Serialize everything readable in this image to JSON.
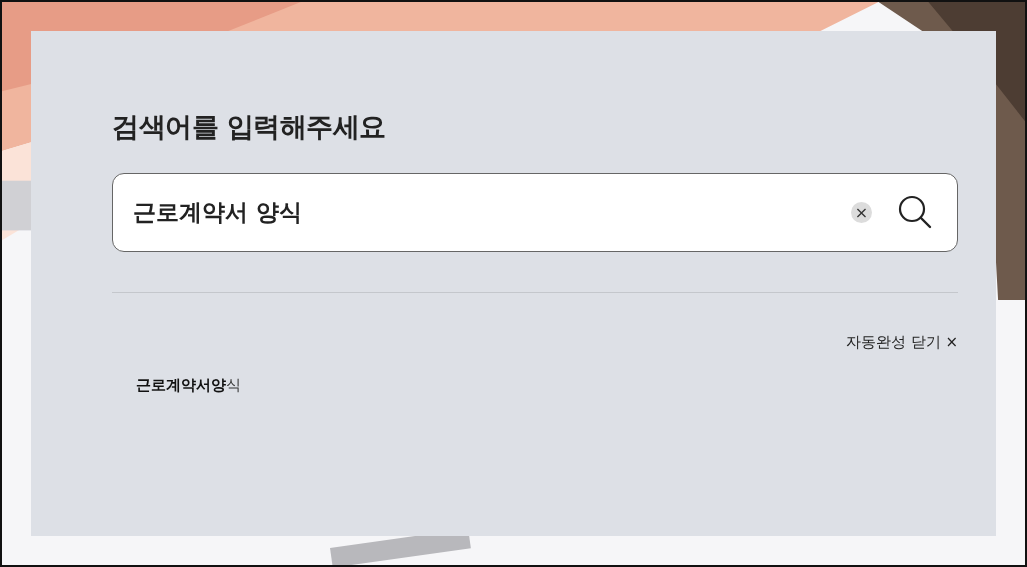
{
  "search_panel": {
    "title": "검색어를 입력해주세요",
    "search": {
      "value": "근로계약서 양식",
      "clear_icon": "×"
    },
    "autocomplete": {
      "close_label": "자동완성 닫기",
      "close_icon": "×",
      "suggestions": [
        "**근로계약서양**식"
      ]
    }
  }
}
